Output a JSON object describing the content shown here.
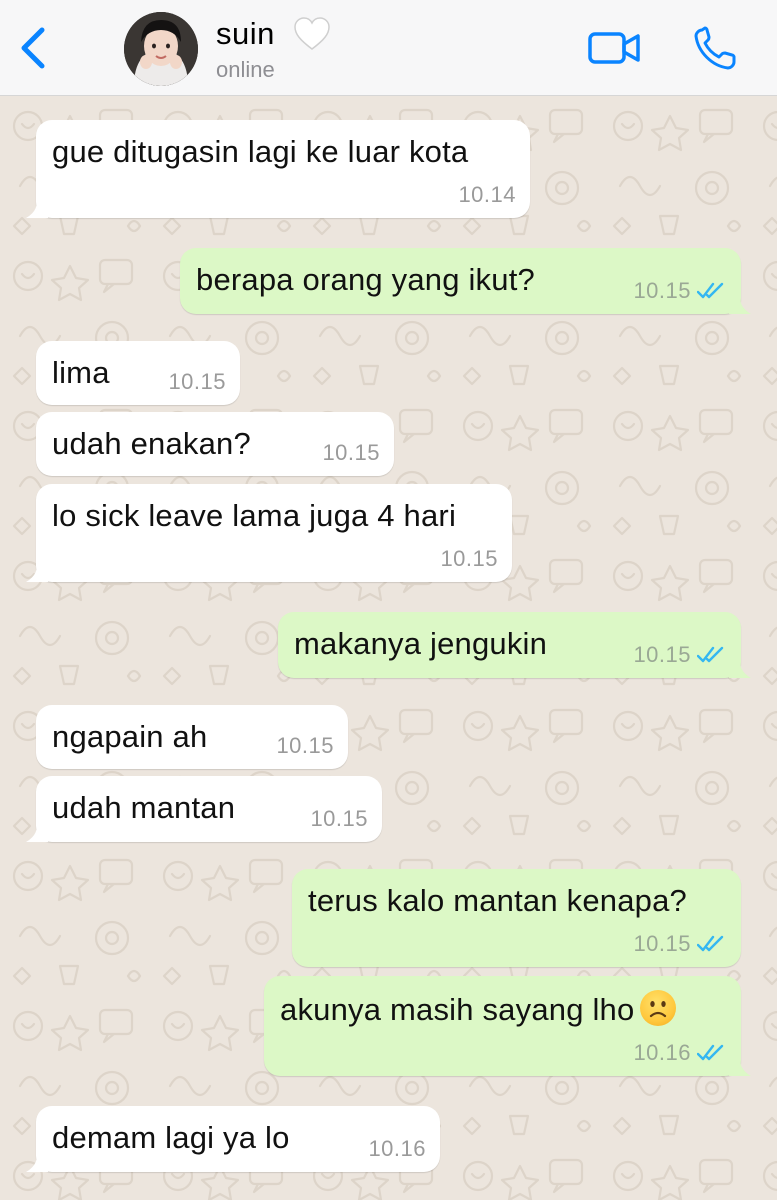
{
  "header": {
    "contact_name": "suin",
    "status": "online",
    "colors": {
      "accent": "#0A84FF",
      "background": "#F7F7F8"
    },
    "icons": [
      "chevron-left-icon",
      "white-heart-icon",
      "video-camera-icon",
      "phone-icon"
    ]
  },
  "chat": {
    "colors": {
      "incoming": "#FFFFFF",
      "outgoing": "#DCF8C6",
      "wallpaper": "#ECE5DD",
      "read_ticks": "#34B7F1"
    },
    "messages": [
      {
        "direction": "in",
        "text": "gue ditugasin lagi ke luar kota",
        "time": "10.14"
      },
      {
        "direction": "out",
        "text": "berapa orang yang ikut?",
        "time": "10.15",
        "status": "read"
      },
      {
        "direction": "in",
        "text": "lima",
        "time": "10.15"
      },
      {
        "direction": "in",
        "text": "udah enakan?",
        "time": "10.15"
      },
      {
        "direction": "in",
        "text": "lo sick leave lama juga 4 hari",
        "time": "10.15"
      },
      {
        "direction": "out",
        "text": "makanya jengukin",
        "time": "10.15",
        "status": "read"
      },
      {
        "direction": "in",
        "text": "ngapain ah",
        "time": "10.15"
      },
      {
        "direction": "in",
        "text": "udah mantan",
        "time": "10.15"
      },
      {
        "direction": "out",
        "text": "terus kalo mantan kenapa?",
        "time": "10.15",
        "status": "read"
      },
      {
        "direction": "out",
        "text": "akunya masih sayang lho",
        "emoji": "slightly-frowning-face",
        "time": "10.16",
        "status": "read"
      },
      {
        "direction": "in",
        "text": "demam lagi ya lo",
        "time": "10.16"
      }
    ]
  }
}
